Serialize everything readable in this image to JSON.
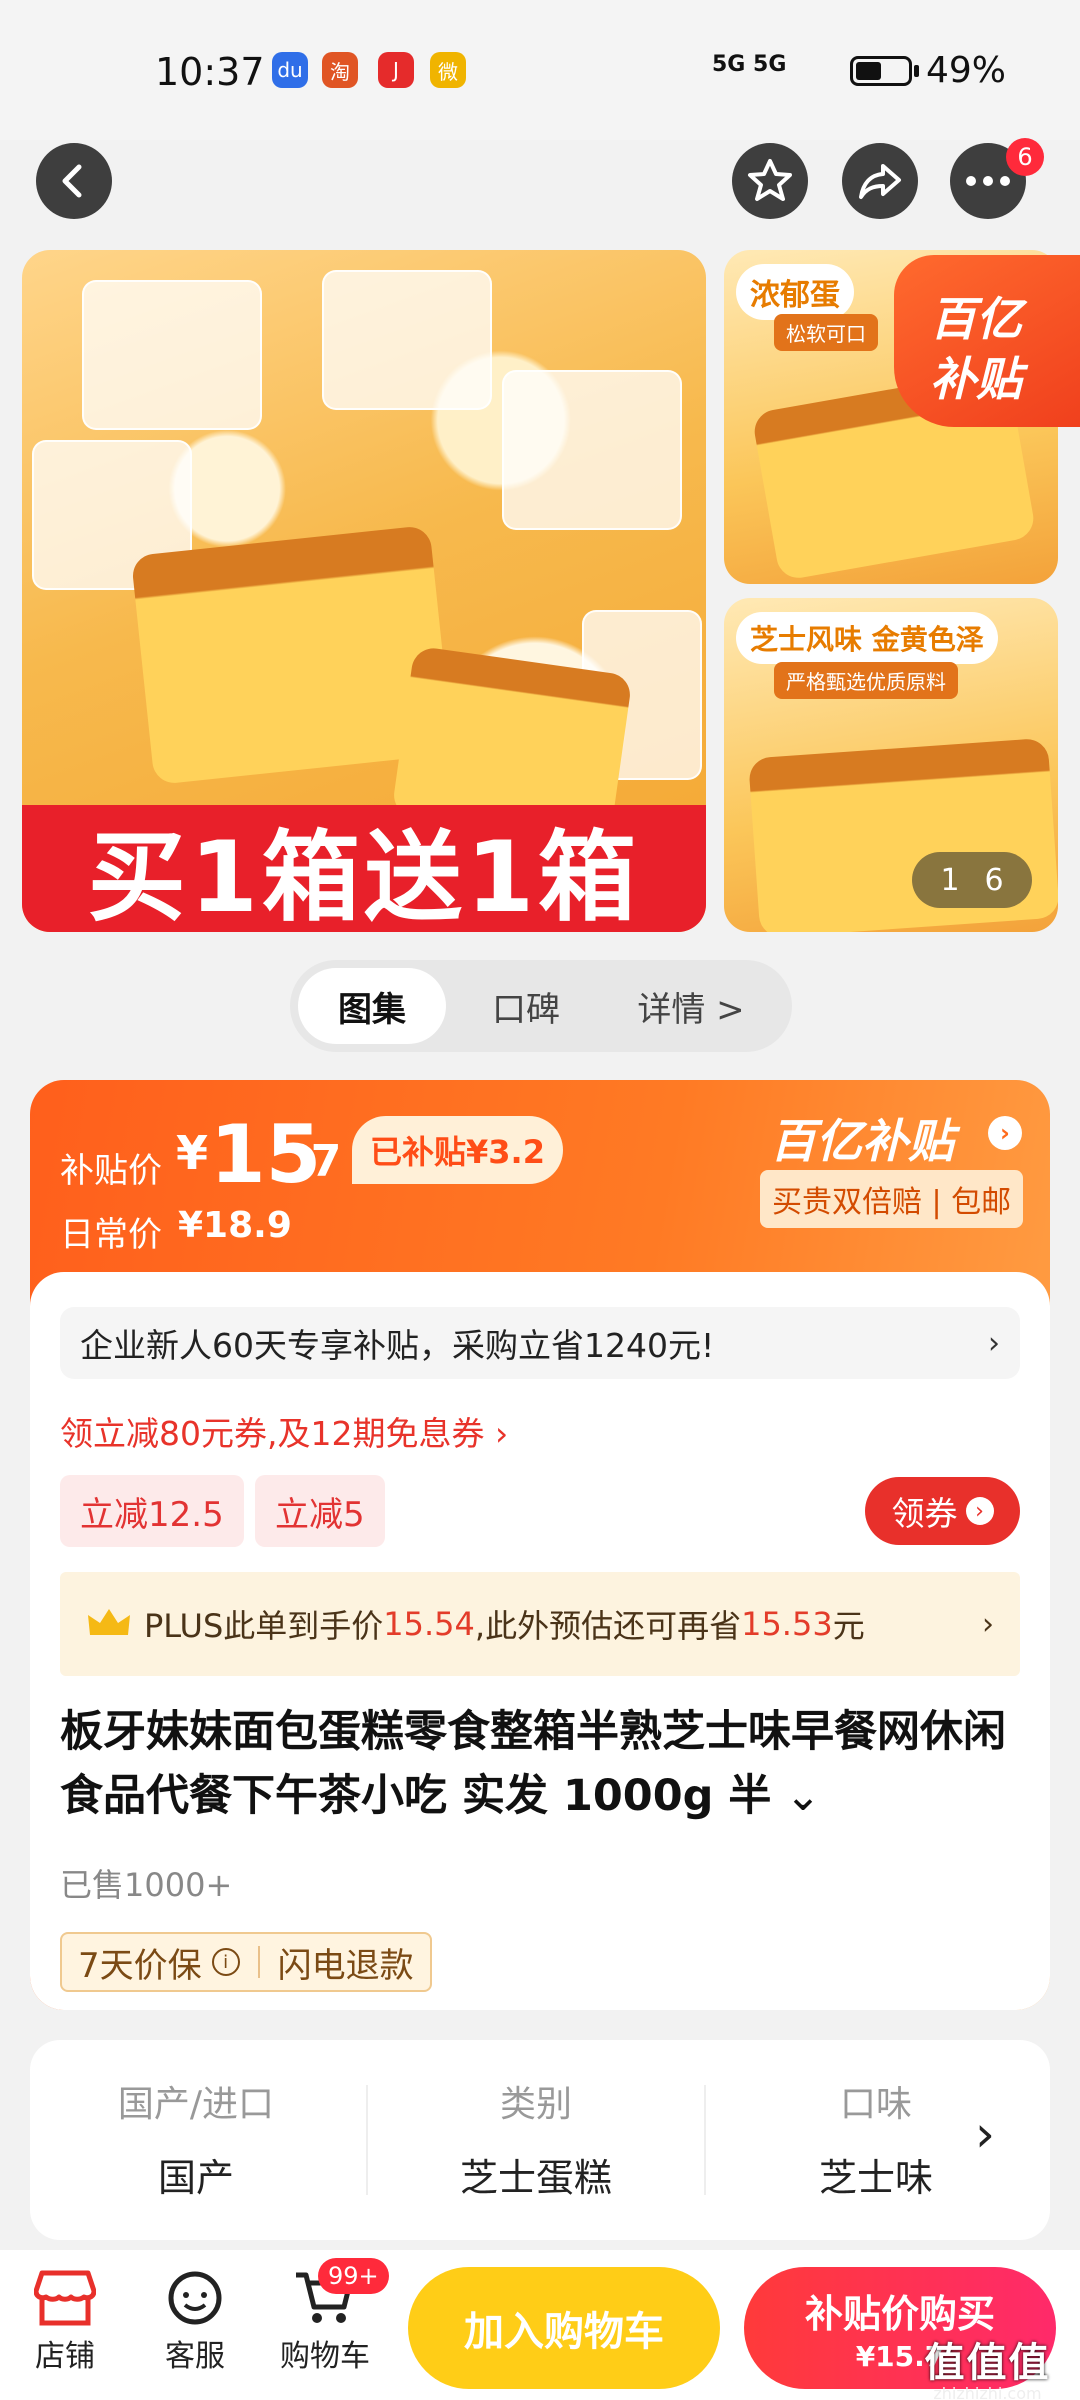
{
  "status_bar": {
    "time": "10:37",
    "signal": "5G 5G",
    "battery": "49%",
    "battery_level": 0.49
  },
  "top_actions": {
    "message_count": "6"
  },
  "gallery": {
    "main_banner": "买1箱送1箱",
    "thumb1_tag": "浓郁蛋",
    "thumb1_sub": "松软可口",
    "thumb2_tag": "芝士风味 金黄色泽",
    "thumb2_sub": "严格甄选优质原料",
    "subsidy_badge_line1": "百亿",
    "subsidy_badge_line2": "补贴",
    "pager_current": "1",
    "pager_total": "6"
  },
  "tabs": [
    {
      "label": "图集"
    },
    {
      "label": "口碑"
    },
    {
      "label": "详情 >"
    }
  ],
  "price": {
    "label": "补贴价",
    "currency": "¥",
    "integer": "15",
    "decimal": ".7",
    "subsidized": "已补贴¥3.2",
    "daily_label": "日常价",
    "daily_price": "¥18.9",
    "brand": "百亿补贴",
    "guarantee": "买贵双倍赔 | 包邮"
  },
  "promo": {
    "new_user": "企业新人60天专享补贴，采购立省1240元!",
    "coupon_link": "领立减80元券,及12期免息券 ›",
    "chips": [
      "立减12.5",
      "立减5"
    ],
    "get_coupon": "领券",
    "plus_prefix": "PLUS此单到手价",
    "plus_price": "15.54",
    "plus_middle": ",此外预估还可再省",
    "plus_save": "15.53",
    "plus_suffix": "元"
  },
  "product": {
    "title": "板牙妹妹面包蛋糕零食整箱半熟芝士味早餐网休闲食品代餐下午茶小吃 实发 1000g 半",
    "sold": "已售1000+",
    "service_tags": [
      "7天价保",
      "闪电退款"
    ]
  },
  "attributes": [
    {
      "label": "国产/进口",
      "value": "国产"
    },
    {
      "label": "类别",
      "value": "芝士蛋糕"
    },
    {
      "label": "口味",
      "value": "芝士味"
    }
  ],
  "bottom_bar": {
    "store": "店铺",
    "service": "客服",
    "cart": "购物车",
    "cart_badge": "99+",
    "add_to_cart": "加入购物车",
    "buy_now": "补贴价购买",
    "buy_price": "¥15.7"
  },
  "watermark": {
    "big": "值值值",
    "small": "zhizhizhi.com"
  },
  "colors": {
    "accent": "#ff5f1c",
    "red": "#e8302b",
    "yellow": "#ffcd17"
  }
}
